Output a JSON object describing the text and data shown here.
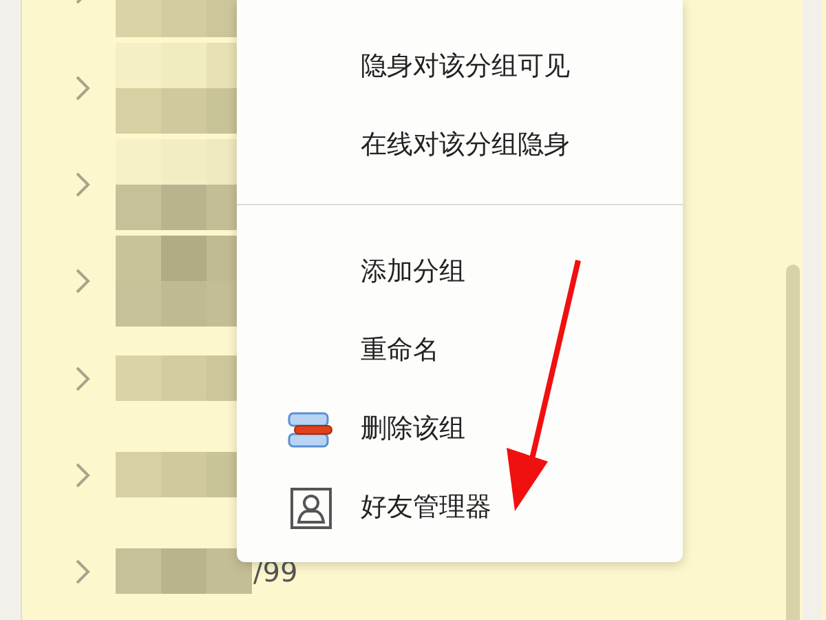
{
  "groups": [
    {
      "expanded": false
    },
    {
      "expanded": false
    },
    {
      "expanded": false
    },
    {
      "expanded": false
    },
    {
      "expanded": false
    },
    {
      "expanded": false
    },
    {
      "expanded": false,
      "label": "/99"
    }
  ],
  "context_menu": {
    "sections": [
      [
        {
          "label": "隐身对该分组可见",
          "kind": "plain"
        },
        {
          "label": "在线对该分组隐身",
          "kind": "plain"
        }
      ],
      [
        {
          "label": "添加分组",
          "kind": "plain"
        },
        {
          "label": "重命名",
          "kind": "plain"
        },
        {
          "label": "删除该组",
          "kind": "delete"
        },
        {
          "label": "好友管理器",
          "kind": "contacts"
        }
      ]
    ]
  }
}
